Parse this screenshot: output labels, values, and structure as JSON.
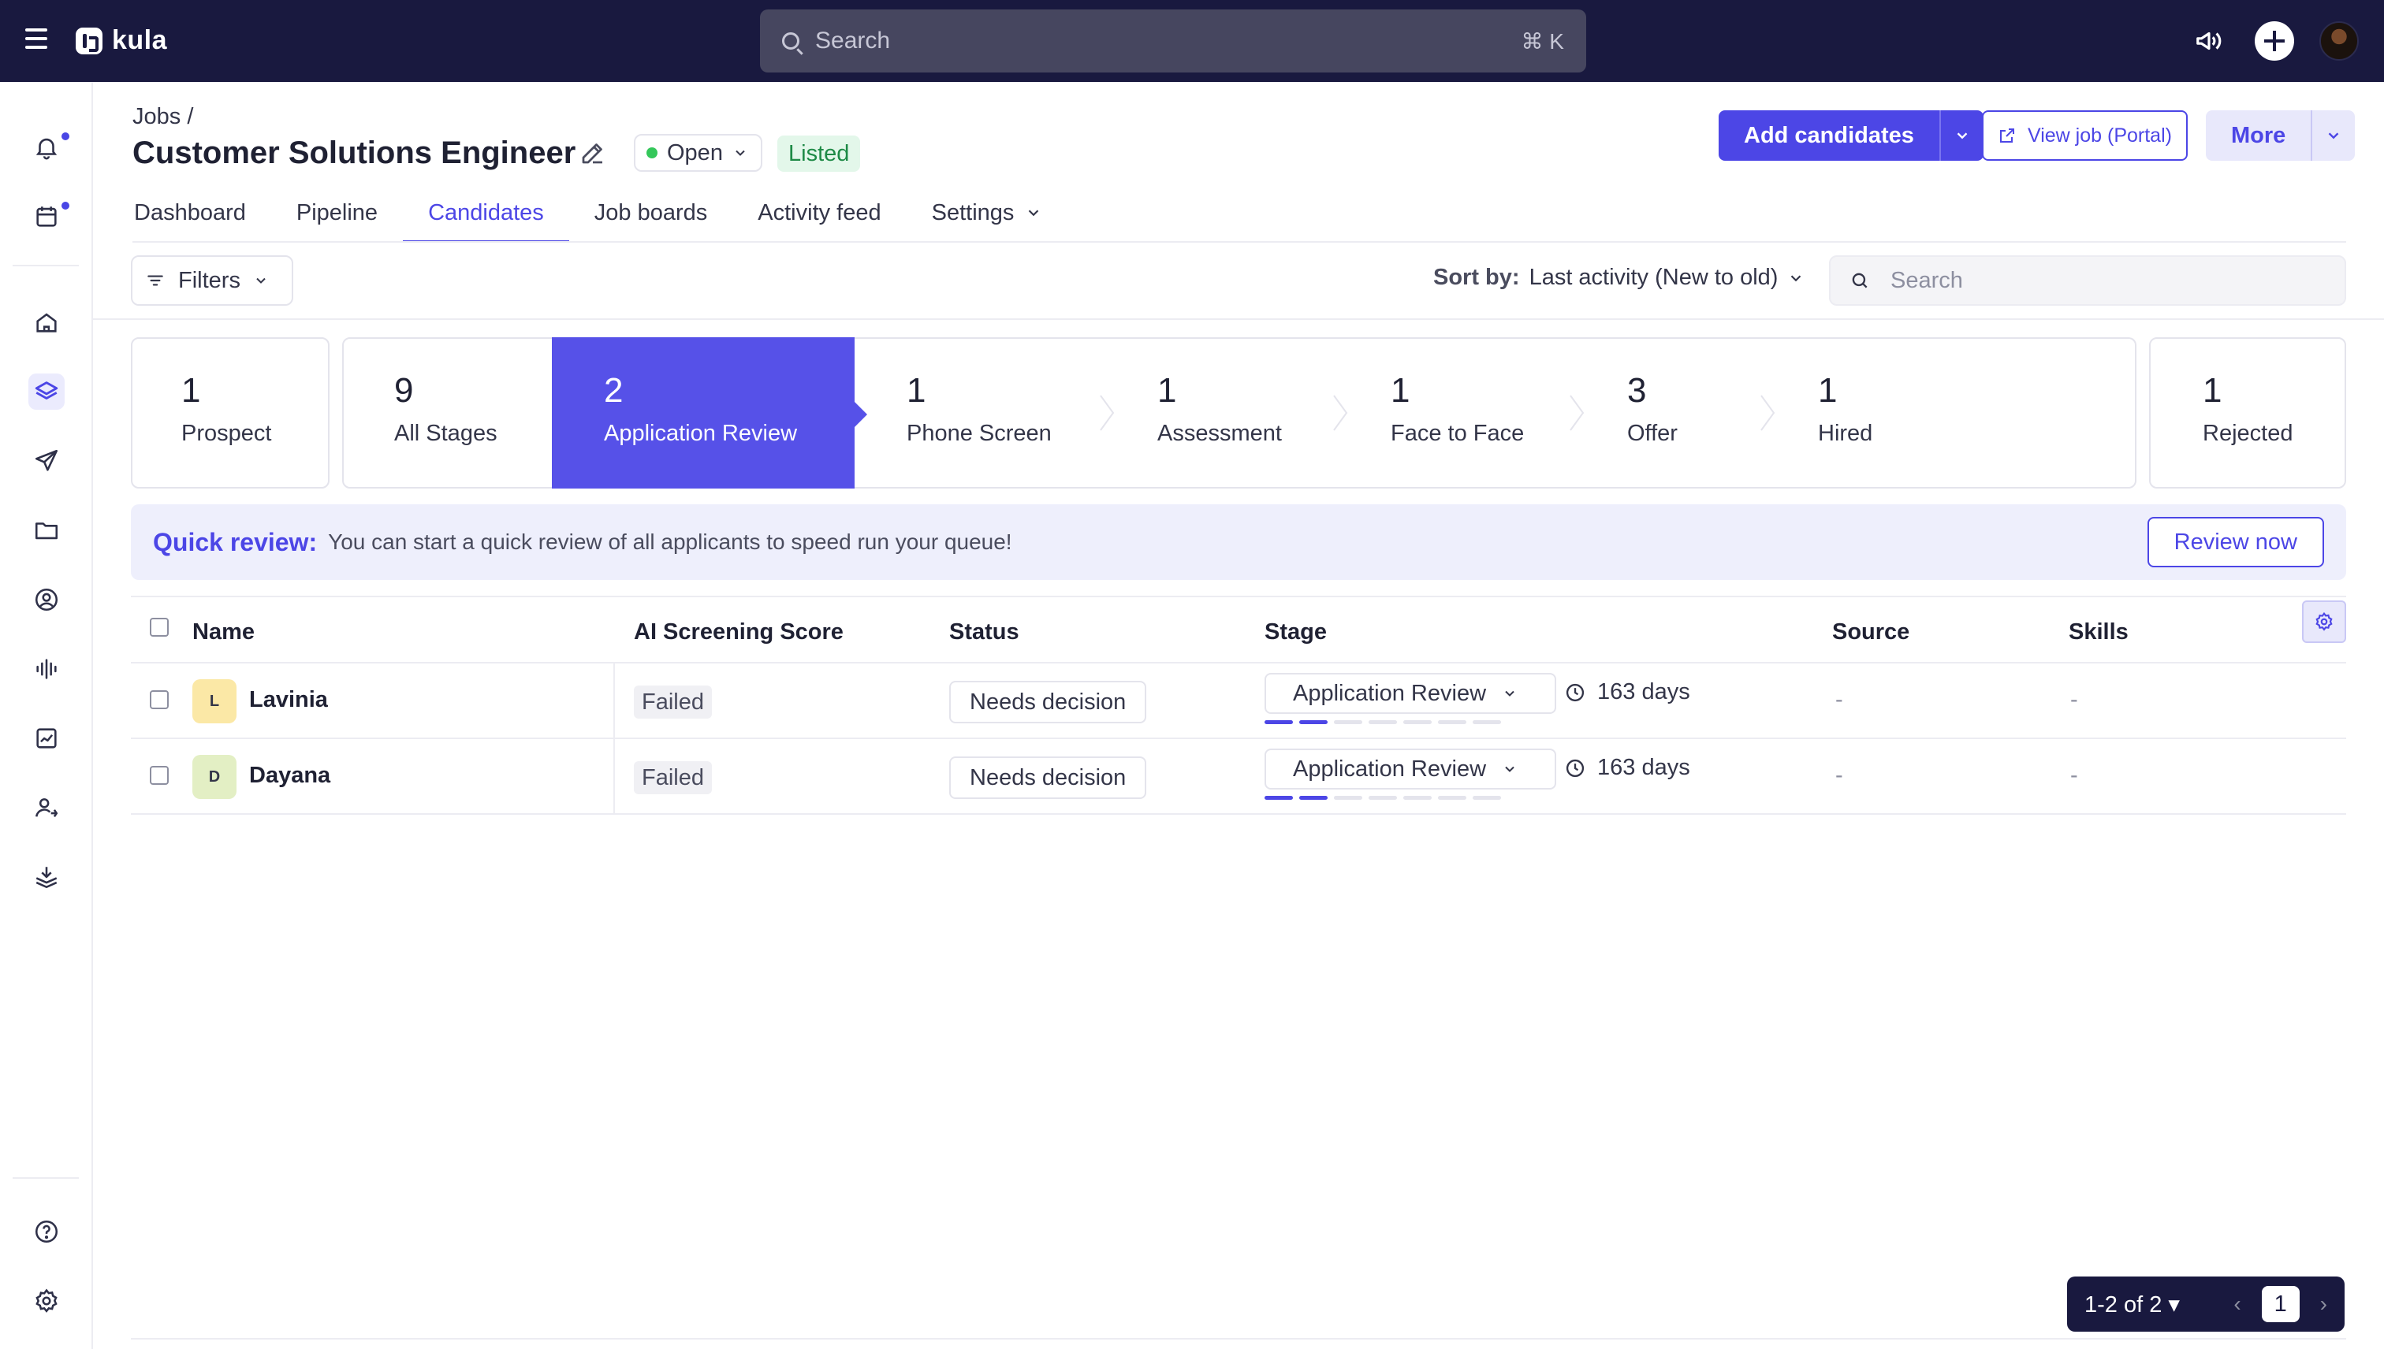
{
  "topbar": {
    "logo_text": "kula",
    "search_placeholder": "Search",
    "search_shortcut": "⌘ K"
  },
  "sidebar": {
    "items": [
      {
        "icon": "bell-icon",
        "dot": true
      },
      {
        "icon": "calendar-icon",
        "dot": true
      },
      {
        "icon": "home-icon"
      },
      {
        "icon": "layers-icon",
        "active": true
      },
      {
        "icon": "send-icon"
      },
      {
        "icon": "folder-icon"
      },
      {
        "icon": "user-circle-icon"
      },
      {
        "icon": "audio-wave-icon"
      },
      {
        "icon": "chart-icon"
      },
      {
        "icon": "users-icon"
      },
      {
        "icon": "inbox-stack-icon"
      },
      {
        "icon": "help-icon"
      },
      {
        "icon": "settings-icon"
      }
    ]
  },
  "header": {
    "breadcrumb": "Jobs /",
    "title": "Customer Solutions Engineer",
    "status": "Open",
    "listed": "Listed",
    "add_candidates": "Add candidates",
    "view_job": "View job (Portal)",
    "more": "More"
  },
  "tabs": [
    "Dashboard",
    "Pipeline",
    "Candidates",
    "Job boards",
    "Activity feed",
    "Settings"
  ],
  "active_tab": "Candidates",
  "toolbar": {
    "filters": "Filters",
    "sort_label": "Sort by:",
    "sort_value": "Last activity (New to old)",
    "search_placeholder": "Search"
  },
  "stages": [
    {
      "count": "1",
      "label": "Prospect"
    },
    {
      "count": "9",
      "label": "All Stages"
    },
    {
      "count": "2",
      "label": "Application Review",
      "active": true
    },
    {
      "count": "1",
      "label": "Phone Screen"
    },
    {
      "count": "1",
      "label": "Assessment"
    },
    {
      "count": "1",
      "label": "Face to Face"
    },
    {
      "count": "3",
      "label": "Offer"
    },
    {
      "count": "1",
      "label": "Hired"
    },
    {
      "count": "1",
      "label": "Rejected"
    }
  ],
  "quick_review": {
    "title": "Quick review:",
    "text": "You can start a quick review of all applicants to speed run your queue!",
    "button": "Review now"
  },
  "table": {
    "columns": [
      "Name",
      "AI Screening Score",
      "Status",
      "Stage",
      "Source",
      "Skills"
    ],
    "rows": [
      {
        "initial": "L",
        "avatar_color": "#fbe8a6",
        "name": "Lavinia",
        "score": "Failed",
        "status": "Needs decision",
        "stage": "Application Review",
        "days": "163 days",
        "progress_steps": 7,
        "progress_done": 2,
        "source": "-",
        "skills": "-"
      },
      {
        "initial": "D",
        "avatar_color": "#e3efc4",
        "name": "Dayana",
        "score": "Failed",
        "status": "Needs decision",
        "stage": "Application Review",
        "days": "163 days",
        "progress_steps": 7,
        "progress_done": 2,
        "source": "-",
        "skills": "-"
      }
    ]
  },
  "pagination": {
    "range": "1-2 of 2 ▾",
    "current_page": "1"
  },
  "colors": {
    "primary": "#4c46e6",
    "topbar": "#19193f",
    "listed_bg": "#e3f7ea",
    "open_dot": "#34c75a"
  }
}
